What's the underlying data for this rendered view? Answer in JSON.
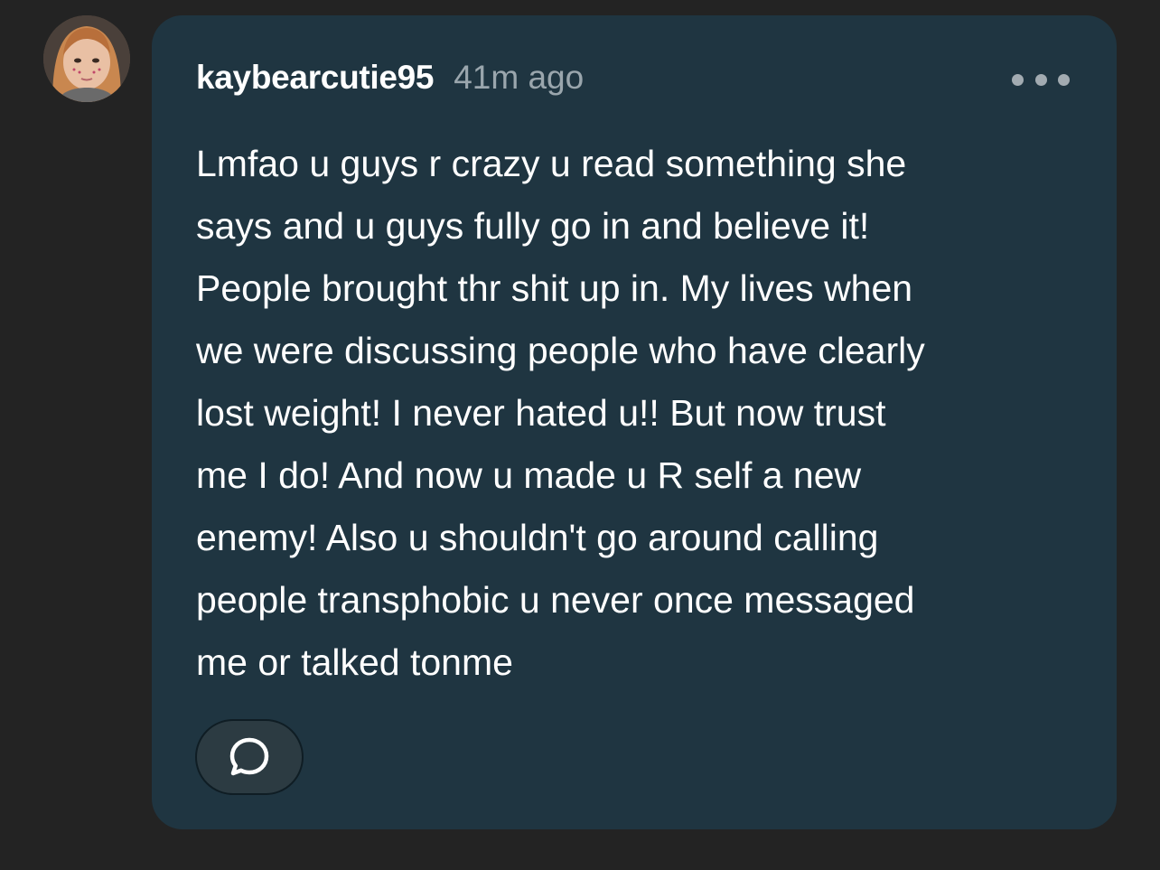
{
  "comment": {
    "author": {
      "username": "kaybearcutie95",
      "avatar_icon": "profile-photo"
    },
    "timestamp": "41m ago",
    "body": "Lmfao u guys r crazy u read something she\nsays and u guys fully go in and believe it!\nPeople brought thr shit up in. My lives when\nwe were discussing people who have clearly\nlost weight! I never hated u!! But now trust\nme I do! And now u made u R self a new\nenemy! Also u shouldn't go around calling\npeople transphobic u never once messaged\nme or talked tonme",
    "actions": {
      "more_icon": "more-options-icon",
      "reply_icon": "speech-bubble-icon"
    }
  },
  "colors": {
    "page_background": "#232323",
    "card_background": "#1f3541",
    "username": "#ffffff",
    "timestamp": "#9aa6ad",
    "body_text": "#ffffff",
    "icon": "#a2abb1"
  }
}
